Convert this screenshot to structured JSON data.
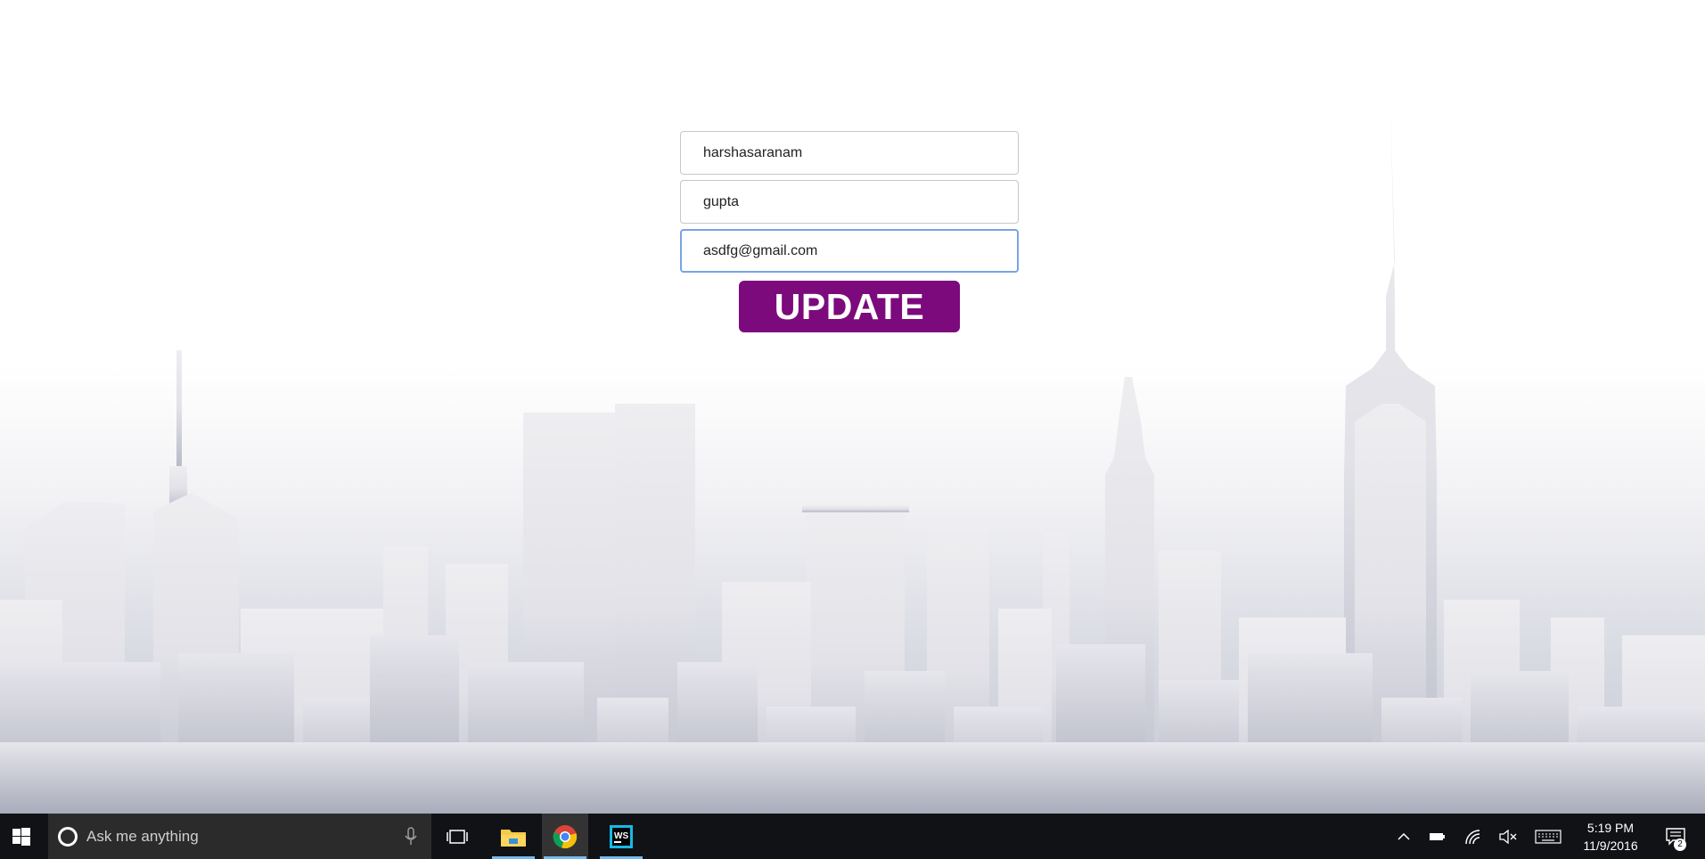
{
  "form": {
    "first_name_value": "harshasaranam",
    "last_name_value": "gupta",
    "email_value": "asdfg@gmail.com",
    "update_label": "UPDATE"
  },
  "colors": {
    "button": "#7c0a7c",
    "focus_border": "#7aa3e6",
    "taskbar": "#101216"
  },
  "taskbar": {
    "search_placeholder": "Ask me anything",
    "apps": [
      "file-explorer-icon",
      "chrome-icon",
      "webstorm-icon"
    ],
    "clock_time": "5:19 PM",
    "clock_date": "11/9/2016",
    "notification_count": "2"
  }
}
